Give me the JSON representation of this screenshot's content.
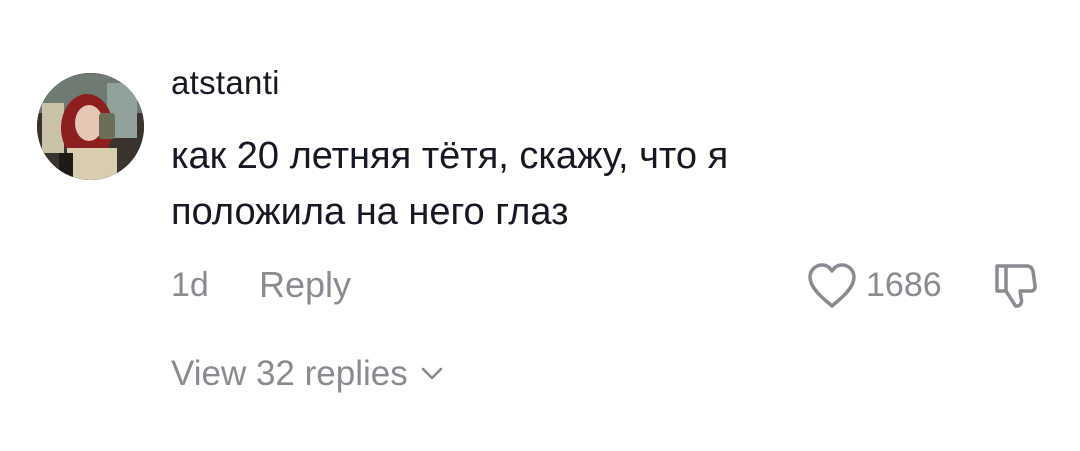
{
  "comment": {
    "username": "atstanti",
    "text_line1": "как 20 летняя тётя, скажу, что я",
    "text_line2": "положила на него глаз",
    "time": "1d",
    "reply_label": "Reply",
    "like_count": "1686",
    "view_replies_label": "View 32 replies"
  },
  "icons": {
    "avatar": "user-avatar",
    "like": "heart-outline-icon",
    "dislike": "thumbs-down-outline-icon",
    "expand": "chevron-down-icon"
  },
  "colors": {
    "primary_text": "#161823",
    "secondary_text": "#8a8b91",
    "background": "#ffffff"
  }
}
